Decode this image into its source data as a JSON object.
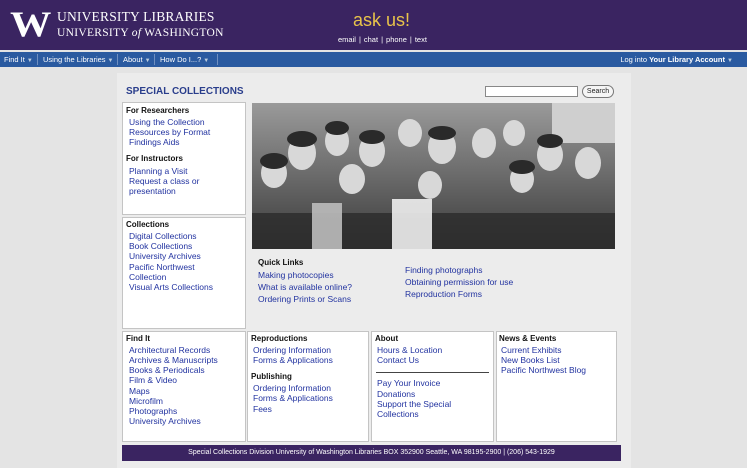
{
  "header": {
    "logo_mark": "W",
    "university_line1": "UNIVERSITY LIBRARIES",
    "university_line2_a": "UNIVERSITY",
    "university_line2_of": "of",
    "university_line2_b": "WASHINGTON",
    "ask_us": "ask us!",
    "ask_options": [
      "email",
      "chat",
      "phone",
      "text"
    ],
    "ask_separator": "|"
  },
  "nav": {
    "items": [
      "Find It",
      "Using the Libraries",
      "About",
      "How Do I...?"
    ],
    "login_prefix": "Log into",
    "login_bold": "Your Library Account",
    "login_arrow": "▼"
  },
  "page": {
    "title": "SPECIAL COLLECTIONS",
    "search_button": "Search",
    "search_value": ""
  },
  "researchers": {
    "heading": "For Researchers",
    "links": [
      "Using the Collection",
      "Resources by Format",
      "Findings Aids"
    ]
  },
  "instructors": {
    "heading": "For Instructors",
    "links": [
      "Planning a Visit",
      "Request a class or",
      "presentation"
    ]
  },
  "collections": {
    "heading": "Collections",
    "links": [
      "Digital Collections",
      "Book Collections",
      "University Archives",
      "Pacific Northwest",
      "Collection",
      "Visual Arts Collections"
    ]
  },
  "quick_links": {
    "heading": "Quick Links",
    "left": [
      "Making photocopies",
      "What is available online?",
      "Ordering Prints or Scans"
    ],
    "right": [
      "Finding photographs",
      "Obtaining permission for use",
      "Reproduction Forms"
    ]
  },
  "find_it": {
    "heading": "Find It",
    "links": [
      "Architectural Records",
      "Archives & Manuscripts",
      "Books & Periodicals",
      "Film & Video",
      "Maps",
      "Microfilm",
      "Photographs",
      "University Archives"
    ]
  },
  "reproductions": {
    "heading": "Reproductions",
    "links": [
      "Ordering Information",
      "Forms & Applications"
    ],
    "publishing_heading": "Publishing",
    "publishing_links": [
      "Ordering Information",
      "Forms & Applications",
      "Fees"
    ]
  },
  "about": {
    "heading": "About",
    "links": [
      "Hours & Location",
      "Contact Us"
    ],
    "links2": [
      "Pay Your Invoice",
      "Donations",
      "Support the Special",
      "Collections"
    ]
  },
  "news": {
    "heading": "News & Events",
    "links": [
      "Current Exhibits",
      "New Books List",
      "Pacific Northwest Blog"
    ]
  },
  "footer": {
    "text": "Special Collections Division University of Washington Libraries BOX 352900 Seattle, WA 98195-2900 | (206) 543-1929"
  },
  "colors": {
    "header_purple": "#3a2461",
    "nav_blue": "#2a5aa0",
    "ask_gold": "#e8c34a",
    "link_blue": "#2233a0"
  }
}
